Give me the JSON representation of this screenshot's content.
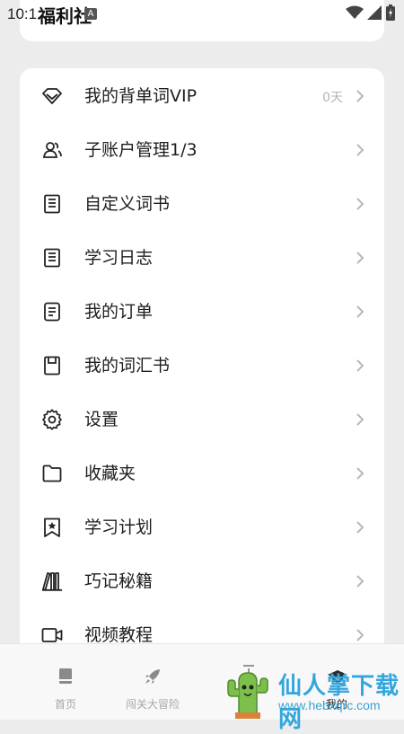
{
  "status_bar": {
    "time": "10:1",
    "notification_badge": "A"
  },
  "top_card": {
    "title": "福利社"
  },
  "menu": {
    "items": [
      {
        "label": "我的背单词VIP",
        "trail": "0天",
        "icon": "diamond-icon"
      },
      {
        "label": "子账户管理1/3",
        "trail": "",
        "icon": "users-icon"
      },
      {
        "label": "自定义词书",
        "trail": "",
        "icon": "notebook-icon"
      },
      {
        "label": "学习日志",
        "trail": "",
        "icon": "notebook-icon"
      },
      {
        "label": "我的订单",
        "trail": "",
        "icon": "document-icon"
      },
      {
        "label": "我的词汇书",
        "trail": "",
        "icon": "book-icon"
      },
      {
        "label": "设置",
        "trail": "",
        "icon": "gear-icon"
      },
      {
        "label": "收藏夹",
        "trail": "",
        "icon": "folder-icon"
      },
      {
        "label": "学习计划",
        "trail": "",
        "icon": "bookmark-star-icon"
      },
      {
        "label": "巧记秘籍",
        "trail": "",
        "icon": "books-icon"
      },
      {
        "label": "视频教程",
        "trail": "",
        "icon": "video-icon"
      }
    ]
  },
  "bottom_nav": {
    "items": [
      {
        "label": "首页",
        "icon": "book-icon"
      },
      {
        "label": "闯关大冒险",
        "icon": "rocket-icon"
      },
      {
        "label": "",
        "icon": "download-icon"
      },
      {
        "label": "我的",
        "icon": "graduation-cap-icon"
      }
    ]
  },
  "watermark": {
    "title": "仙人掌下载网",
    "url": "www.hebxqrc.com",
    "icon": "cactus-icon"
  },
  "colors": {
    "background": "#ececec",
    "card": "#ffffff",
    "text": "#1e1e1e",
    "muted": "#b3b3b3",
    "watermark_blue": "#33a6de"
  }
}
